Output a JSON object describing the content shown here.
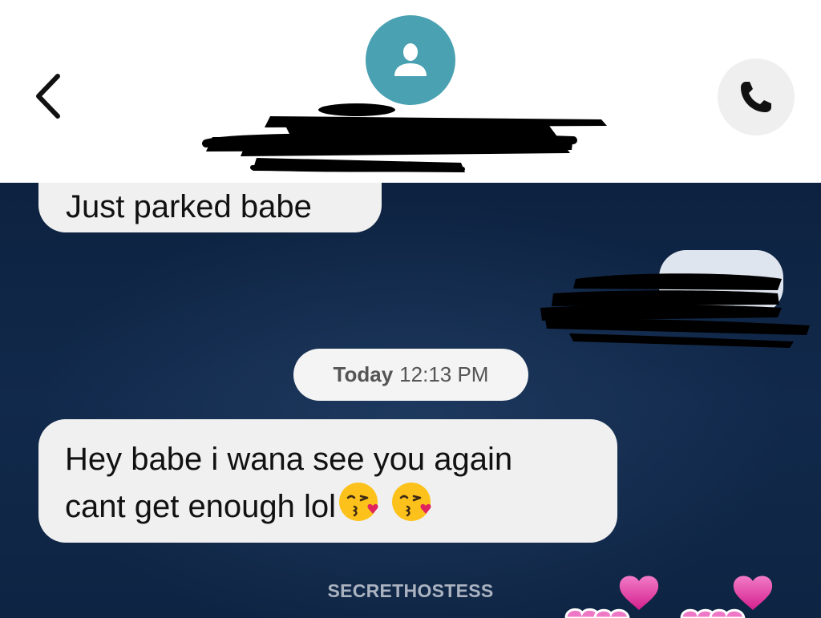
{
  "header": {
    "back_icon": "chevron-left-icon",
    "avatar_icon": "person-icon",
    "call_icon": "phone-icon",
    "colors": {
      "avatar_bg": "#4aa1b2",
      "call_bg": "#efefef"
    }
  },
  "messages": [
    {
      "direction": "incoming",
      "text": "Just parked babe"
    },
    {
      "direction": "outgoing",
      "text": ""
    },
    {
      "direction": "incoming",
      "lines": [
        "Hey babe i wana see you again",
        "cant get enough lol"
      ],
      "emojis": [
        "face-blowing-kiss-icon",
        "face-blowing-kiss-icon"
      ]
    }
  ],
  "timestamp": {
    "day": "Today",
    "time": "12:13 PM"
  },
  "watermark": "SECRETHOSTESS",
  "decorations": {
    "hearts_color": "#e0339b"
  }
}
